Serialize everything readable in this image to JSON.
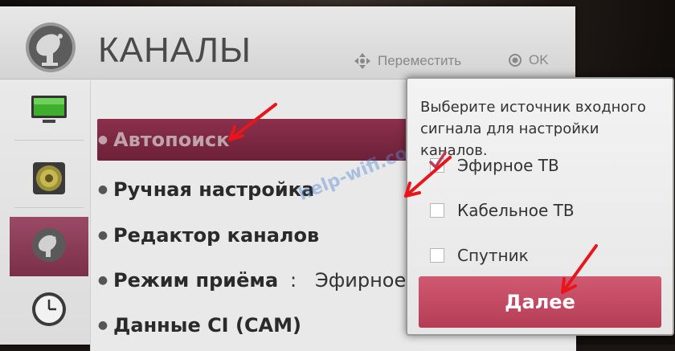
{
  "header": {
    "title": "КАНАЛЫ",
    "hint_move_label": "Переместить",
    "hint_ok_label": "OK"
  },
  "categories": [
    {
      "name": "picture",
      "icon": "tv-screen-icon"
    },
    {
      "name": "sound",
      "icon": "speaker-icon"
    },
    {
      "name": "channels",
      "icon": "satellite-dish-icon",
      "active": true
    },
    {
      "name": "time",
      "icon": "clock-icon"
    }
  ],
  "menu_items": [
    {
      "label": "Автопоиск",
      "selected": true
    },
    {
      "label": "Ручная настройка"
    },
    {
      "label": "Редактор каналов"
    },
    {
      "label": "Режим приёма",
      "separator": ":",
      "value": "Эфирное ТВ"
    },
    {
      "label": "Данные CI (CAM)"
    }
  ],
  "dialog": {
    "text": "Выберите источник входного сигнала для настройки каналов.",
    "options": [
      {
        "label": "Эфирное ТВ",
        "checked": true
      },
      {
        "label": "Кабельное ТВ",
        "checked": false
      },
      {
        "label": "Спутник",
        "checked": false
      }
    ],
    "next_label": "Далее"
  },
  "watermark": "help-wifi.com",
  "colors": {
    "accent": "#8c2f4d",
    "button": "#c44a63",
    "annotation": "#e8151b"
  }
}
